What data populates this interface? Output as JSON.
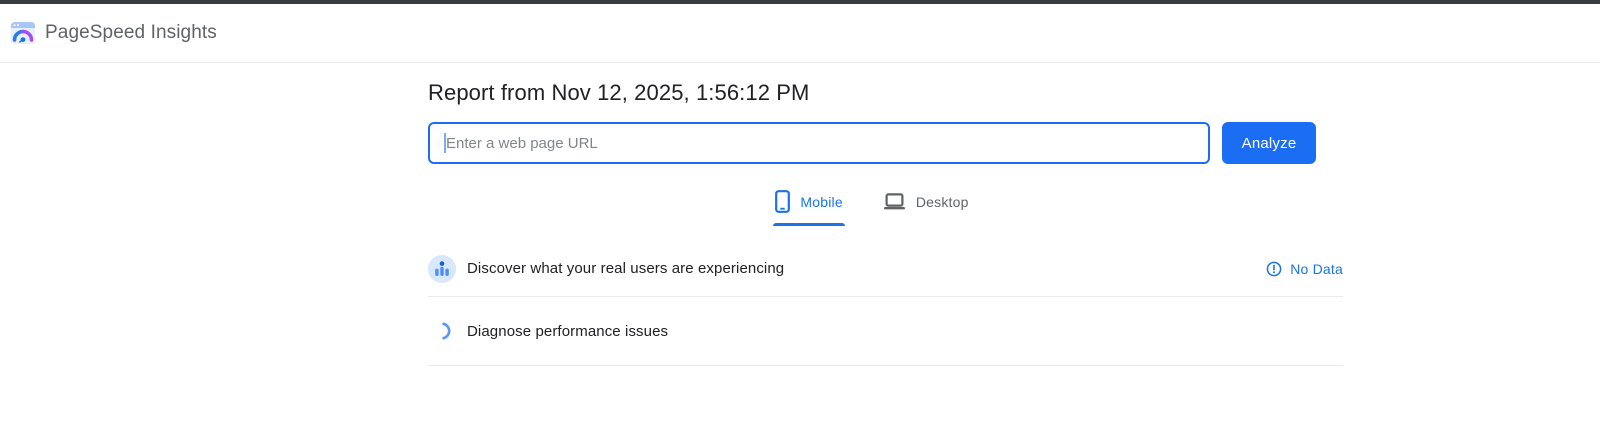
{
  "header": {
    "title": "PageSpeed Insights",
    "logo": "pagespeed-gauge-logo"
  },
  "report": {
    "heading": "Report from Nov 12, 2025, 1:56:12 PM"
  },
  "search": {
    "placeholder": "Enter a web page URL",
    "value": "",
    "analyze_label": "Analyze"
  },
  "tabs": {
    "items": [
      {
        "label": "Mobile",
        "icon": "smartphone-icon",
        "active": true
      },
      {
        "label": "Desktop",
        "icon": "laptop-icon",
        "active": false
      }
    ]
  },
  "sections": {
    "field_data": {
      "icon": "real-users-icon",
      "title": "Discover what your real users are experiencing",
      "status": {
        "icon": "error-outline-icon",
        "label": "No Data"
      }
    },
    "lab_data": {
      "icon": "loading-arc-icon",
      "title": "Diagnose performance issues"
    }
  },
  "colors": {
    "accent_blue": "#1a73e8",
    "button_blue": "#1b6ef3",
    "text_primary": "#202124",
    "text_secondary": "#5f6368",
    "placeholder_gray": "#80868b",
    "divider": "#e8eaed",
    "topbar_dark": "#3a3d40",
    "icon_circle_bg": "#d7e7fc",
    "logo_purple": "#a64df1"
  }
}
